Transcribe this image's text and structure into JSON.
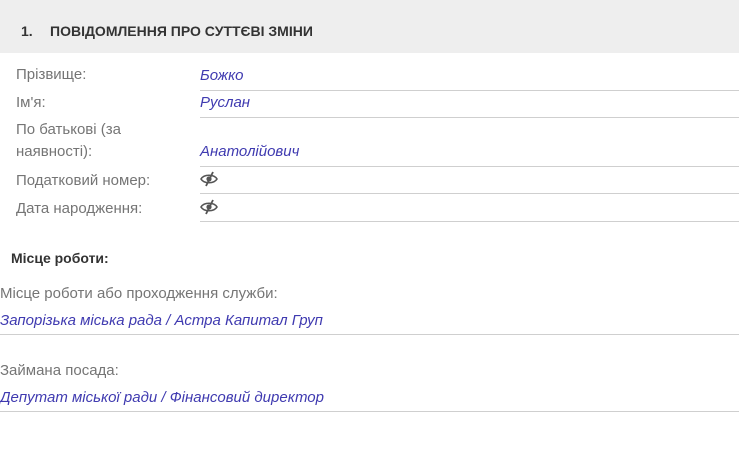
{
  "section": {
    "number": "1.",
    "title": "ПОВІДОМЛЕННЯ ПРО СУТТЄВІ ЗМІНИ"
  },
  "person": {
    "surname_label": "Прізвище:",
    "surname": "Божко",
    "name_label": "Ім'я:",
    "name": "Руслан",
    "patronymic_label_line1": "По батькові (за",
    "patronymic_label_line2": "наявності):",
    "patronymic": "Анатолійович",
    "tax_label": "Податковий номер:",
    "tax_icon": "eye-hidden-icon",
    "dob_label": "Дата народження:",
    "dob_icon": "eye-hidden-icon"
  },
  "work": {
    "heading": "Місце роботи:",
    "place_label": "Місце роботи або проходження служби:",
    "place_value": "Запорізька міська рада / Астра Капитал Груп",
    "position_label": "Займана посада:",
    "position_value": "Депутат міської ради / Фінансовий директор"
  },
  "colors": {
    "value_text": "#3f3ab0",
    "label_text": "#757575",
    "header_bg": "#eeeeee"
  }
}
